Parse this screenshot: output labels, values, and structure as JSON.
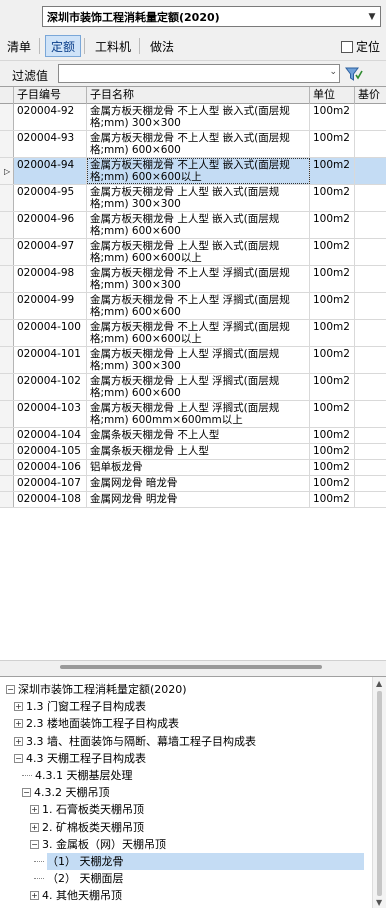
{
  "book_select": {
    "value": "深圳市装饰工程消耗量定额(2020)"
  },
  "tabs": [
    "清单",
    "定额",
    "工料机",
    "做法"
  ],
  "active_tab": 1,
  "locate_checkbox": {
    "label": "定位",
    "checked": false
  },
  "filter": {
    "label": "过滤值",
    "value": ""
  },
  "grid": {
    "columns": [
      "子目编号",
      "子目名称",
      "单位",
      "基价"
    ],
    "rows": [
      {
        "code": "020004-92",
        "name": "金属方板天棚龙骨 不上人型 嵌入式(面层规格;mm) 300×300",
        "unit": "100m2"
      },
      {
        "code": "020004-93",
        "name": "金属方板天棚龙骨 不上人型 嵌入式(面层规格;mm) 600×600",
        "unit": "100m2"
      },
      {
        "code": "020004-94",
        "name": "金属方板天棚龙骨 不上人型 嵌入式(面层规格;mm) 600×600以上",
        "unit": "100m2",
        "selected": true
      },
      {
        "code": "020004-95",
        "name": "金属方板天棚龙骨 上人型 嵌入式(面层规格;mm) 300×300",
        "unit": "100m2"
      },
      {
        "code": "020004-96",
        "name": "金属方板天棚龙骨 上人型 嵌入式(面层规格;mm) 600×600",
        "unit": "100m2"
      },
      {
        "code": "020004-97",
        "name": "金属方板天棚龙骨 上人型 嵌入式(面层规格;mm) 600×600以上",
        "unit": "100m2"
      },
      {
        "code": "020004-98",
        "name": "金属方板天棚龙骨 不上人型 浮搁式(面层规格;mm) 300×300",
        "unit": "100m2"
      },
      {
        "code": "020004-99",
        "name": "金属方板天棚龙骨 不上人型 浮搁式(面层规格;mm) 600×600",
        "unit": "100m2"
      },
      {
        "code": "020004-100",
        "name": "金属方板天棚龙骨 不上人型 浮搁式(面层规格;mm) 600×600以上",
        "unit": "100m2"
      },
      {
        "code": "020004-101",
        "name": "金属方板天棚龙骨 上人型 浮搁式(面层规格;mm) 300×300",
        "unit": "100m2"
      },
      {
        "code": "020004-102",
        "name": "金属方板天棚龙骨 上人型 浮搁式(面层规格;mm) 600×600",
        "unit": "100m2"
      },
      {
        "code": "020004-103",
        "name": "金属方板天棚龙骨 上人型 浮搁式(面层规格;mm) 600mm×600mm以上",
        "unit": "100m2"
      },
      {
        "code": "020004-104",
        "name": "金属条板天棚龙骨 不上人型",
        "unit": "100m2"
      },
      {
        "code": "020004-105",
        "name": "金属条板天棚龙骨 上人型",
        "unit": "100m2"
      },
      {
        "code": "020004-106",
        "name": "铝单板龙骨",
        "unit": "100m2"
      },
      {
        "code": "020004-107",
        "name": "金属网龙骨 暗龙骨",
        "unit": "100m2"
      },
      {
        "code": "020004-108",
        "name": "金属网龙骨 明龙骨",
        "unit": "100m2"
      }
    ]
  },
  "tree": [
    {
      "label": "深圳市装饰工程消耗量定额(2020)",
      "depth": 0,
      "toggle": "minus"
    },
    {
      "label": "1.3 门窗工程子目构成表",
      "depth": 1,
      "toggle": "plus"
    },
    {
      "label": "2.3 楼地面装饰工程子目构成表",
      "depth": 1,
      "toggle": "plus"
    },
    {
      "label": "3.3 墙、柱面装饰与隔断、幕墙工程子目构成表",
      "depth": 1,
      "toggle": "plus"
    },
    {
      "label": "4.3 天棚工程子目构成表",
      "depth": 1,
      "toggle": "minus"
    },
    {
      "label": "4.3.1 天棚基层处理",
      "depth": 2,
      "toggle": "leaf"
    },
    {
      "label": "4.3.2 天棚吊顶",
      "depth": 2,
      "toggle": "minus"
    },
    {
      "label": "1. 石膏板类天棚吊顶",
      "depth": 3,
      "toggle": "plus"
    },
    {
      "label": "2. 矿棉板类天棚吊顶",
      "depth": 3,
      "toggle": "plus"
    },
    {
      "label": "3. 金属板（网）天棚吊顶",
      "depth": 3,
      "toggle": "minus"
    },
    {
      "label": "（1） 天棚龙骨",
      "depth": 4,
      "toggle": "leaf",
      "selected": true
    },
    {
      "label": "（2） 天棚面层",
      "depth": 4,
      "toggle": "leaf"
    },
    {
      "label": "4. 其他天棚吊顶",
      "depth": 3,
      "toggle": "plus"
    }
  ]
}
